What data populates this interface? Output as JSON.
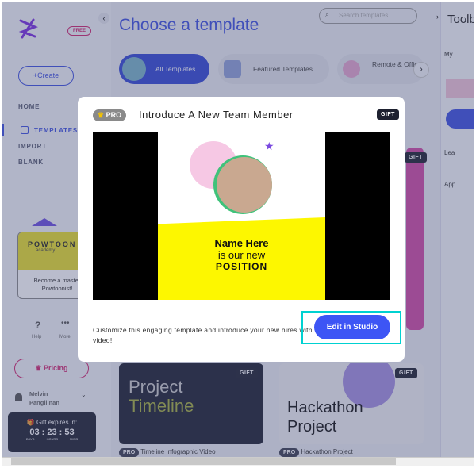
{
  "sidebar": {
    "badge": "FREE",
    "create": "+Create",
    "nav": [
      {
        "label": "HOME"
      },
      {
        "label": "TEMPLATES",
        "active": true
      },
      {
        "label": "IMPORT"
      },
      {
        "label": "BLANK"
      }
    ],
    "academy": {
      "brand": "POWTOON",
      "sub": "academy",
      "text": "Become a master Powtoonist!"
    },
    "help": "Help",
    "more": "More",
    "pricing": "Pricing",
    "user": {
      "first": "Melvin",
      "last": "Pangilinan"
    },
    "gift_timer": {
      "title": "Gift expires in:",
      "days": "03",
      "hours": "23",
      "mins": "53",
      "days_label": "DAYS",
      "hours_label": "HOURS",
      "mins_label": "MINS"
    }
  },
  "main": {
    "title": "Choose a template",
    "search_placeholder": "Search templates",
    "categories": [
      {
        "label": "All Templates",
        "active": true
      },
      {
        "label": "Featured Templates"
      },
      {
        "label": "Remote & Office"
      }
    ],
    "cards": [
      {
        "title": "Timeline Infographic Video",
        "thumb_line1": "Project",
        "thumb_line2": "Timeline",
        "badge": "PRO",
        "gift": "GIFT"
      },
      {
        "title": "Hackathon Project",
        "thumb_line1": "Hackathon",
        "thumb_line2": "Project",
        "badge": "PRO",
        "gift": "GIFT"
      }
    ],
    "side_gift": "GIFT"
  },
  "rpanel": {
    "title": "Toolb",
    "items": [
      "My",
      "Lea",
      "App"
    ]
  },
  "modal": {
    "badge": "PRO",
    "title": "Introduce A New Team Member",
    "gift": "GIFT",
    "preview": {
      "line1": "Name Here",
      "line2": "is our new",
      "line3": "POSITION"
    },
    "description": "Customize this engaging template and introduce your new hires with video!",
    "button": "Edit in Studio"
  },
  "colors": {
    "accent": "#3d4fe0",
    "brand_pink": "#d0246f",
    "highlight": "#00d1d1",
    "yellow": "#fdf700"
  }
}
